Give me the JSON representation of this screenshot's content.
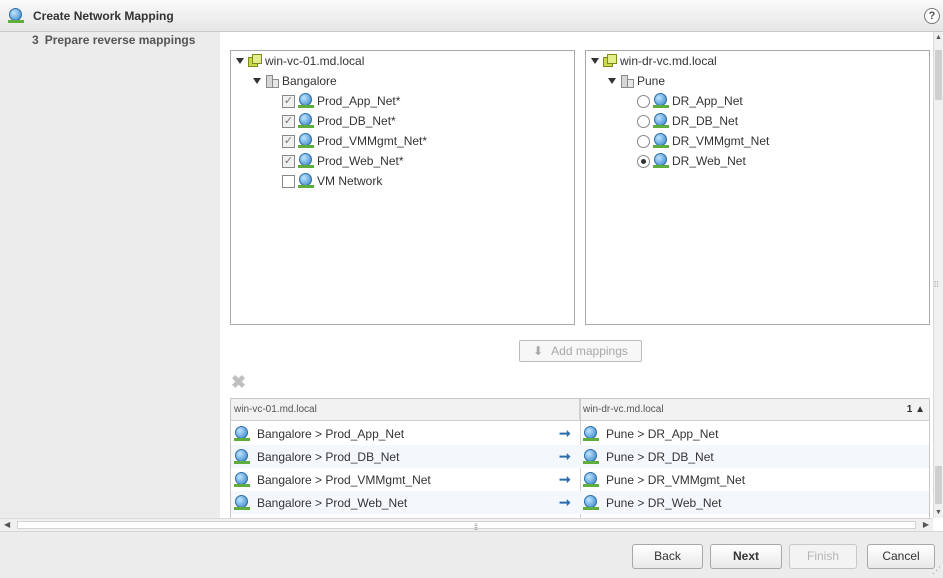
{
  "window": {
    "title": "Create Network Mapping",
    "help_label": "?"
  },
  "wizard": {
    "step": {
      "number": "3",
      "label": "Prepare reverse mappings"
    }
  },
  "source_tree": {
    "vcenter": "win-vc-01.md.local",
    "datacenter": "Bangalore",
    "networks": [
      {
        "label": "Prod_App_Net*",
        "checked": true
      },
      {
        "label": "Prod_DB_Net*",
        "checked": true
      },
      {
        "label": "Prod_VMMgmt_Net*",
        "checked": true
      },
      {
        "label": "Prod_Web_Net*",
        "checked": true
      },
      {
        "label": "VM Network",
        "checked": false
      }
    ]
  },
  "target_tree": {
    "vcenter": "win-dr-vc.md.local",
    "datacenter": "Pune",
    "networks": [
      {
        "label": "DR_App_Net",
        "selected": false
      },
      {
        "label": "DR_DB_Net",
        "selected": false
      },
      {
        "label": "DR_VMMgmt_Net",
        "selected": false
      },
      {
        "label": "DR_Web_Net",
        "selected": true
      }
    ]
  },
  "add_mappings_label": "Add mappings",
  "grid": {
    "col1_header": "win-vc-01.md.local",
    "col2_header": "win-dr-vc.md.local",
    "sort_indicator": "1 ▲",
    "rows": [
      {
        "source": "Bangalore > Prod_App_Net",
        "target": "Pune > DR_App_Net"
      },
      {
        "source": "Bangalore > Prod_DB_Net",
        "target": "Pune > DR_DB_Net"
      },
      {
        "source": "Bangalore > Prod_VMMgmt_Net",
        "target": "Pune > DR_VMMgmt_Net"
      },
      {
        "source": "Bangalore > Prod_Web_Net",
        "target": "Pune > DR_Web_Net"
      }
    ]
  },
  "buttons": {
    "back": "Back",
    "next": "Next",
    "finish": "Finish",
    "cancel": "Cancel"
  },
  "icons": {
    "window": "network-globe-icon",
    "vcenter": "vcenter-icon",
    "datacenter": "datacenter-icon",
    "network": "network-icon",
    "map_arrow": "right-arrow-icon",
    "remove": "remove-x-icon"
  },
  "colors": {
    "accent_blue": "#2c6dab",
    "network_green": "#5fae3d",
    "titlebar": "#e6e6e6"
  }
}
